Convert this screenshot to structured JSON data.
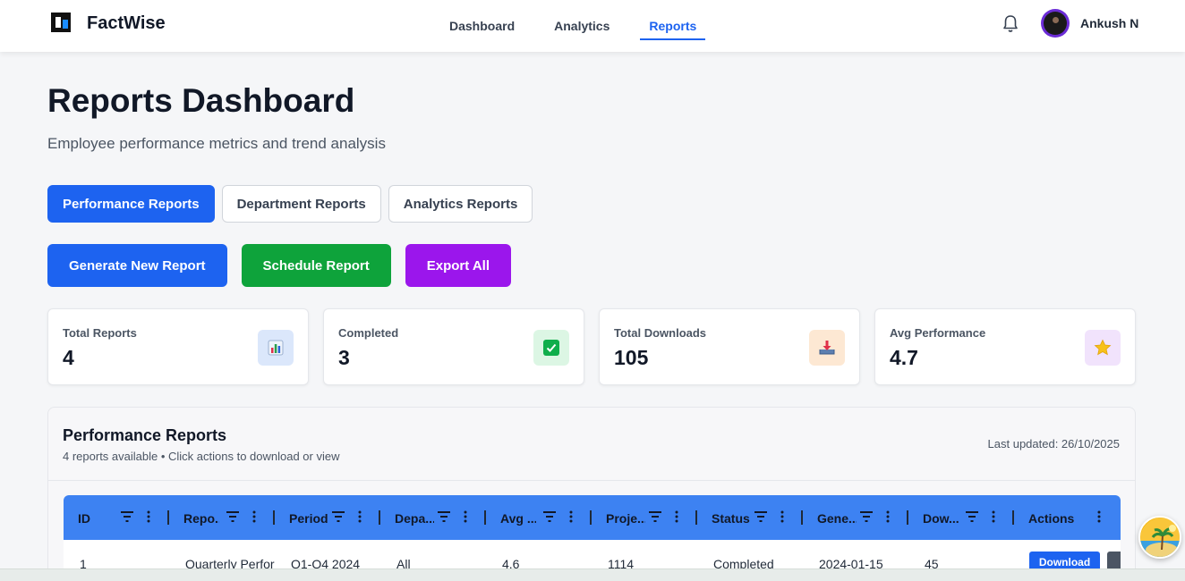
{
  "brand": {
    "name": "FactWise"
  },
  "nav": {
    "links": [
      {
        "label": "Dashboard",
        "active": false
      },
      {
        "label": "Analytics",
        "active": false
      },
      {
        "label": "Reports",
        "active": true
      }
    ],
    "user_name": "Ankush N"
  },
  "header": {
    "title": "Reports Dashboard",
    "subtitle": "Employee performance metrics and trend analysis"
  },
  "tabs": [
    {
      "label": "Performance Reports",
      "active": true
    },
    {
      "label": "Department Reports",
      "active": false
    },
    {
      "label": "Analytics Reports",
      "active": false
    }
  ],
  "actions": {
    "generate": "Generate New Report",
    "schedule": "Schedule Report",
    "export": "Export All"
  },
  "stats": [
    {
      "label": "Total Reports",
      "value": "4",
      "icon": "bar-chart-icon",
      "color": "#dbe7fb"
    },
    {
      "label": "Completed",
      "value": "3",
      "icon": "check-box-icon",
      "color": "#dcf6e4"
    },
    {
      "label": "Total Downloads",
      "value": "105",
      "icon": "download-tray-icon",
      "color": "#fde8d3"
    },
    {
      "label": "Avg Performance",
      "value": "4.7",
      "icon": "star-icon",
      "color": "#f1e3fc"
    }
  ],
  "panel": {
    "title": "Performance Reports",
    "subtitle": "4 reports available • Click actions to download or view",
    "updated": "Last updated: 26/10/2025"
  },
  "grid": {
    "columns": [
      "ID",
      "Repo...",
      "Period",
      "Depa...",
      "Avg ...",
      "Proje...",
      "Status",
      "Gene...",
      "Dow...",
      "Actions"
    ],
    "rows": [
      {
        "id": "1",
        "report": "Quarterly Perforı",
        "period": "Q1-Q4 2024",
        "department": "All",
        "avg": "4.6",
        "projects": "1114",
        "status": "Completed",
        "generated": "2024-01-15",
        "downloads": "45",
        "action": "Download"
      }
    ]
  },
  "accent_color": "#1d63f0"
}
